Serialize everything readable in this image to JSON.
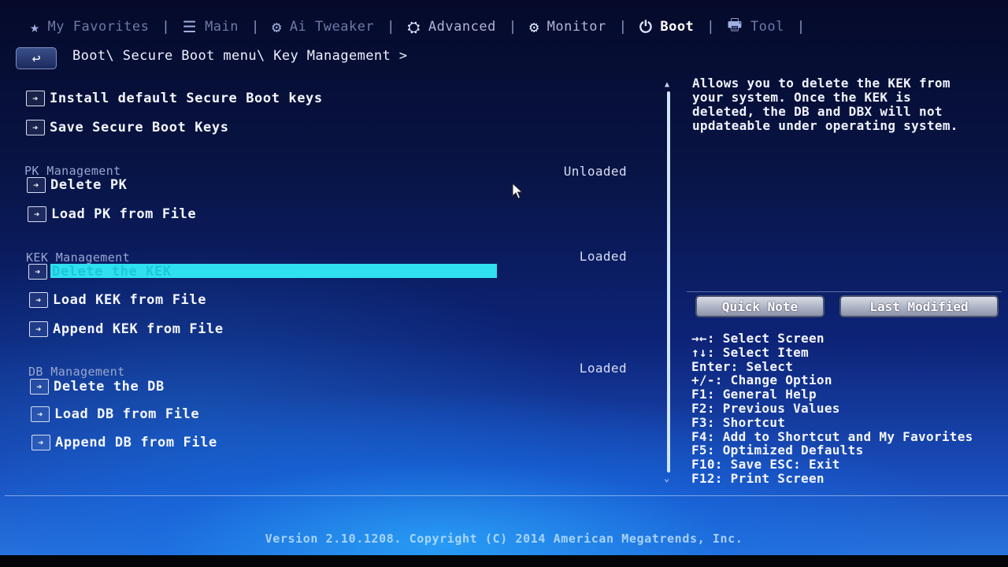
{
  "nav": {
    "tabs": [
      {
        "label": "My Favorites",
        "icon": "star-icon",
        "glyph": "★"
      },
      {
        "label": "Main",
        "icon": "list-icon",
        "glyph": "☰"
      },
      {
        "label": "Ai Tweaker",
        "icon": "tweaker-icon",
        "glyph": "⚙"
      },
      {
        "label": "Advanced",
        "icon": "advanced-icon",
        "glyph": "⛭"
      },
      {
        "label": "Monitor",
        "icon": "monitor-icon",
        "glyph": "⚙"
      },
      {
        "label": "Boot",
        "icon": "power-icon",
        "glyph": "⏻"
      },
      {
        "label": "Tool",
        "icon": "tool-icon",
        "glyph": "🖶"
      }
    ],
    "separator": "|"
  },
  "breadcrumb": {
    "back_glyph": "↩",
    "path": "Boot\\ Secure Boot menu\\ Key Management >"
  },
  "menu": {
    "install_default": "Install default Secure Boot keys",
    "save_keys": "Save Secure Boot Keys",
    "pk": {
      "title": "PK Management",
      "status": "Unloaded",
      "delete": "Delete PK",
      "load": "Load PK from File"
    },
    "kek": {
      "title": "KEK Management",
      "status": "Loaded",
      "delete": "Delete the KEK",
      "load": "Load KEK from File",
      "append": "Append KEK from File"
    },
    "db": {
      "title": "DB Management",
      "status": "Loaded",
      "delete": "Delete the DB",
      "load": "Load DB from File",
      "append": "Append DB from File"
    },
    "arrow_glyph": "➔"
  },
  "help": {
    "text": "Allows you to delete the KEK from\nyour system. Once the KEK is\ndeleted, the DB and DBX will not\nupdateable under operating system."
  },
  "buttons": {
    "quick_note": "Quick Note",
    "last_modified": "Last Modified"
  },
  "keys": [
    "→←: Select Screen",
    "↑↓: Select Item",
    "Enter: Select",
    "+/-: Change Option",
    "F1: General Help",
    "F2: Previous Values",
    "F3: Shortcut",
    "F4: Add to Shortcut and My Favorites",
    "F5: Optimized Defaults",
    "F10: Save  ESC: Exit",
    "F12: Print Screen"
  ],
  "footer": {
    "version": "Version 2.10.1208. Copyright (C) 2014 American Megatrends, Inc."
  },
  "colors": {
    "highlight": "#2fe0f0",
    "selected_text": "#1ec6d8"
  }
}
